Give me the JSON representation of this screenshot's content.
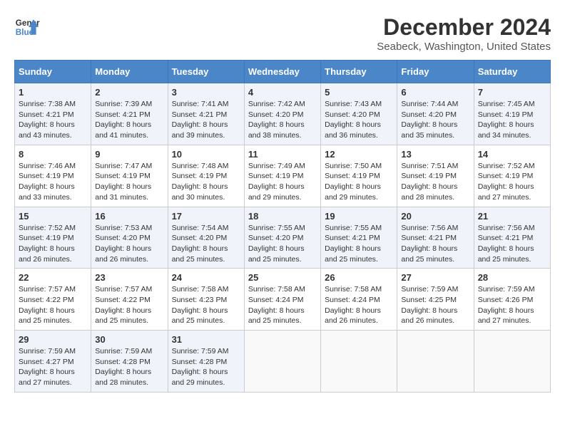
{
  "header": {
    "logo_line1": "General",
    "logo_line2": "Blue",
    "title": "December 2024",
    "subtitle": "Seabeck, Washington, United States"
  },
  "days_of_week": [
    "Sunday",
    "Monday",
    "Tuesday",
    "Wednesday",
    "Thursday",
    "Friday",
    "Saturday"
  ],
  "weeks": [
    [
      {
        "day": "1",
        "sunrise": "7:38 AM",
        "sunset": "4:21 PM",
        "daylight": "8 hours and 43 minutes."
      },
      {
        "day": "2",
        "sunrise": "7:39 AM",
        "sunset": "4:21 PM",
        "daylight": "8 hours and 41 minutes."
      },
      {
        "day": "3",
        "sunrise": "7:41 AM",
        "sunset": "4:21 PM",
        "daylight": "8 hours and 39 minutes."
      },
      {
        "day": "4",
        "sunrise": "7:42 AM",
        "sunset": "4:20 PM",
        "daylight": "8 hours and 38 minutes."
      },
      {
        "day": "5",
        "sunrise": "7:43 AM",
        "sunset": "4:20 PM",
        "daylight": "8 hours and 36 minutes."
      },
      {
        "day": "6",
        "sunrise": "7:44 AM",
        "sunset": "4:20 PM",
        "daylight": "8 hours and 35 minutes."
      },
      {
        "day": "7",
        "sunrise": "7:45 AM",
        "sunset": "4:19 PM",
        "daylight": "8 hours and 34 minutes."
      }
    ],
    [
      {
        "day": "8",
        "sunrise": "7:46 AM",
        "sunset": "4:19 PM",
        "daylight": "8 hours and 33 minutes."
      },
      {
        "day": "9",
        "sunrise": "7:47 AM",
        "sunset": "4:19 PM",
        "daylight": "8 hours and 31 minutes."
      },
      {
        "day": "10",
        "sunrise": "7:48 AM",
        "sunset": "4:19 PM",
        "daylight": "8 hours and 30 minutes."
      },
      {
        "day": "11",
        "sunrise": "7:49 AM",
        "sunset": "4:19 PM",
        "daylight": "8 hours and 29 minutes."
      },
      {
        "day": "12",
        "sunrise": "7:50 AM",
        "sunset": "4:19 PM",
        "daylight": "8 hours and 29 minutes."
      },
      {
        "day": "13",
        "sunrise": "7:51 AM",
        "sunset": "4:19 PM",
        "daylight": "8 hours and 28 minutes."
      },
      {
        "day": "14",
        "sunrise": "7:52 AM",
        "sunset": "4:19 PM",
        "daylight": "8 hours and 27 minutes."
      }
    ],
    [
      {
        "day": "15",
        "sunrise": "7:52 AM",
        "sunset": "4:19 PM",
        "daylight": "8 hours and 26 minutes."
      },
      {
        "day": "16",
        "sunrise": "7:53 AM",
        "sunset": "4:20 PM",
        "daylight": "8 hours and 26 minutes."
      },
      {
        "day": "17",
        "sunrise": "7:54 AM",
        "sunset": "4:20 PM",
        "daylight": "8 hours and 25 minutes."
      },
      {
        "day": "18",
        "sunrise": "7:55 AM",
        "sunset": "4:20 PM",
        "daylight": "8 hours and 25 minutes."
      },
      {
        "day": "19",
        "sunrise": "7:55 AM",
        "sunset": "4:21 PM",
        "daylight": "8 hours and 25 minutes."
      },
      {
        "day": "20",
        "sunrise": "7:56 AM",
        "sunset": "4:21 PM",
        "daylight": "8 hours and 25 minutes."
      },
      {
        "day": "21",
        "sunrise": "7:56 AM",
        "sunset": "4:21 PM",
        "daylight": "8 hours and 25 minutes."
      }
    ],
    [
      {
        "day": "22",
        "sunrise": "7:57 AM",
        "sunset": "4:22 PM",
        "daylight": "8 hours and 25 minutes."
      },
      {
        "day": "23",
        "sunrise": "7:57 AM",
        "sunset": "4:22 PM",
        "daylight": "8 hours and 25 minutes."
      },
      {
        "day": "24",
        "sunrise": "7:58 AM",
        "sunset": "4:23 PM",
        "daylight": "8 hours and 25 minutes."
      },
      {
        "day": "25",
        "sunrise": "7:58 AM",
        "sunset": "4:24 PM",
        "daylight": "8 hours and 25 minutes."
      },
      {
        "day": "26",
        "sunrise": "7:58 AM",
        "sunset": "4:24 PM",
        "daylight": "8 hours and 26 minutes."
      },
      {
        "day": "27",
        "sunrise": "7:59 AM",
        "sunset": "4:25 PM",
        "daylight": "8 hours and 26 minutes."
      },
      {
        "day": "28",
        "sunrise": "7:59 AM",
        "sunset": "4:26 PM",
        "daylight": "8 hours and 27 minutes."
      }
    ],
    [
      {
        "day": "29",
        "sunrise": "7:59 AM",
        "sunset": "4:27 PM",
        "daylight": "8 hours and 27 minutes."
      },
      {
        "day": "30",
        "sunrise": "7:59 AM",
        "sunset": "4:28 PM",
        "daylight": "8 hours and 28 minutes."
      },
      {
        "day": "31",
        "sunrise": "7:59 AM",
        "sunset": "4:28 PM",
        "daylight": "8 hours and 29 minutes."
      },
      null,
      null,
      null,
      null
    ]
  ],
  "labels": {
    "sunrise_prefix": "Sunrise: ",
    "sunset_prefix": "Sunset: ",
    "daylight_prefix": "Daylight: "
  },
  "colors": {
    "header_bg": "#4a86c8",
    "row_odd_bg": "#f0f4fa",
    "row_even_bg": "#ffffff"
  }
}
